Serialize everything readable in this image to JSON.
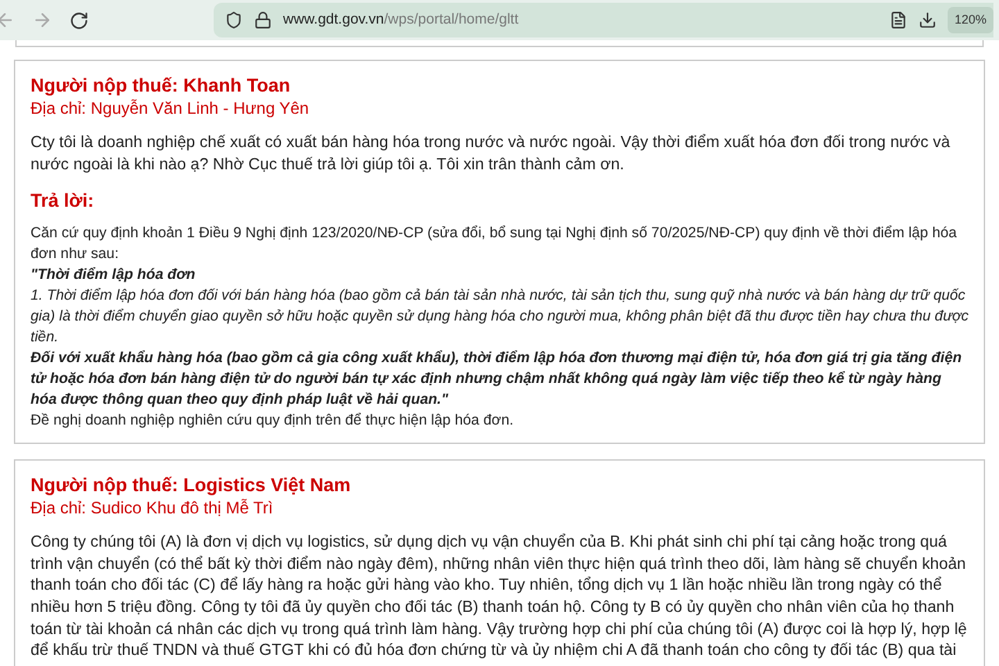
{
  "browser": {
    "url_domain": "www.gdt.gov.vn",
    "url_path": "/wps/portal/home/gltt",
    "zoom": "120%"
  },
  "entries": [
    {
      "taxpayer": "Người nộp thuế: Khanh Toan",
      "address": "Địa chỉ: Nguyễn Văn Linh - Hưng Yên",
      "question": "Cty tôi là doanh nghiệp chế xuất có xuất bán hàng hóa trong nước và nước ngoài. Vậy thời điểm xuất hóa đơn đối trong nước và nước ngoài là khi nào ạ? Nhờ Cục thuế trả lời giúp tôi ạ. Tôi xin trân thành cảm ơn.",
      "answer_heading": "Trả lời:",
      "answer": [
        {
          "kind": "plain",
          "text": "Căn cứ quy định khoản 1 Điều 9 Nghị định 123/2020/NĐ-CP (sửa đổi, bổ sung tại Nghị định số 70/2025/NĐ-CP) quy định về thời điểm lập hóa đơn như sau:"
        },
        {
          "kind": "bold-italic",
          "text": "\"Thời điểm lập hóa đơn"
        },
        {
          "kind": "italic",
          "text": "1. Thời điểm lập hóa đơn đối với bán hàng hóa (bao gồm cả bán tài sản nhà nước, tài sản tịch thu, sung quỹ nhà nước và bán hàng dự trữ quốc gia) là thời điểm chuyển giao quyền sở hữu hoặc quyền sử dụng hàng hóa cho người mua, không phân biệt đã thu được tiền hay chưa thu được tiền."
        },
        {
          "kind": "bold-italic",
          "text": "Đối với xuất khẩu hàng hóa (bao gồm cả gia công xuất khẩu), thời điểm lập hóa đơn thương mại điện tử, hóa đơn giá trị gia tăng điện tử hoặc hóa đơn bán hàng điện tử do người bán tự xác định nhưng chậm nhất không quá ngày làm việc tiếp theo kể từ ngày hàng hóa được thông quan theo quy định pháp luật về hải quan.\""
        },
        {
          "kind": "plain",
          "text": "Đề nghị doanh nghiệp nghiên cứu quy định trên để thực hiện lập hóa đơn."
        }
      ]
    },
    {
      "taxpayer": "Người nộp thuế: Logistics Việt Nam",
      "address": "Địa chỉ: Sudico Khu đô thị Mễ Trì",
      "question": "Công ty chúng tôi (A) là đơn vị dịch vụ logistics, sử dụng dịch vụ vận chuyển của B. Khi phát sinh chi phí tại cảng hoặc trong quá trình vận chuyển (có thể bất kỳ thời điểm nào ngày đêm), những nhân viên thực hiện quá trình theo dõi, làm hàng sẽ chuyển khoản thanh toán cho đối tác (C) để lấy hàng ra hoặc gửi hàng vào kho. Tuy nhiên, tổng dịch vụ 1 lần hoặc nhiều lần trong ngày có thể nhiều hơn 5 triệu đồng. Công ty tôi đã ủy quyền cho đối tác (B) thanh toán hộ. Công ty B có ủy quyền cho nhân viên của họ thanh toán từ tài khoản cá nhân các dịch vụ trong quá trình làm hàng. Vậy trường hợp chi phí của chúng tôi (A) được coi là hợp lý, hợp lệ để khấu trừ thuế TNDN và thuế GTGT khi có đủ hóa đơn chứng từ và ủy nhiệm chi A đã thanh toán cho công ty đối tác (B) qua tài"
    }
  ]
}
